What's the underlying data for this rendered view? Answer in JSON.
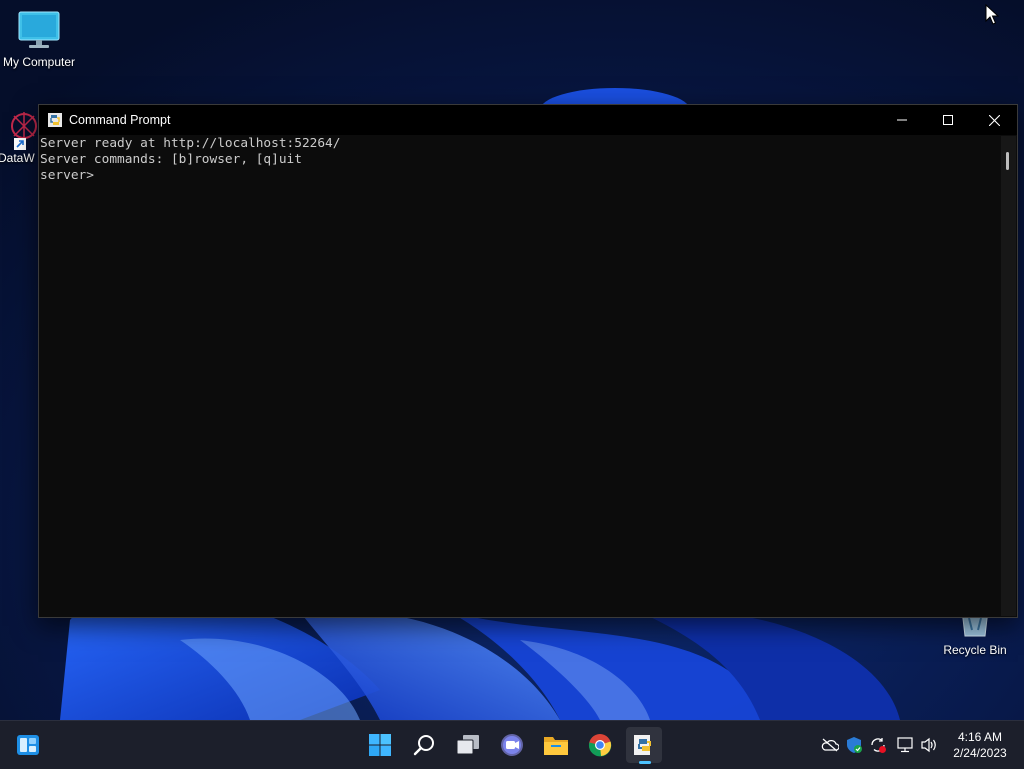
{
  "desktop": {
    "icons": [
      {
        "label": "My Computer"
      },
      {
        "label": "DataW"
      },
      {
        "label": "Recycle Bin"
      }
    ]
  },
  "window": {
    "title": "Command Prompt",
    "console_lines": [
      "Server ready at http://localhost:52264/",
      "Server commands: [b]rowser, [q]uit",
      "server>"
    ]
  },
  "taskbar": {
    "apps": [
      "widgets",
      "start",
      "search",
      "task-view",
      "teams-chat",
      "file-explorer",
      "chrome",
      "python"
    ],
    "active_app": "python",
    "tray_icons": [
      "onedrive-offline",
      "windows-security",
      "sync-error",
      "network",
      "volume"
    ],
    "time": "4:16 AM",
    "date": "2/24/2023"
  },
  "colors": {
    "console_bg": "#0c0c0c",
    "console_text": "#cccccc",
    "taskbar_bg": "#1c1f2b",
    "accent": "#4cc2ff"
  }
}
